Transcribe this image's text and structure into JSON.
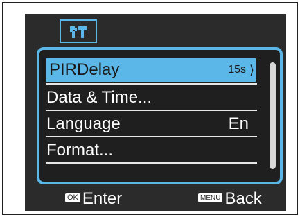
{
  "menu": {
    "items": [
      {
        "label": "PIRDelay",
        "value": "15s"
      },
      {
        "label": "Data & Time...",
        "value": ""
      },
      {
        "label": "Language",
        "value": "En"
      },
      {
        "label": "Format...",
        "value": ""
      }
    ]
  },
  "footer": {
    "ok_badge": "OK",
    "enter_label": "Enter",
    "menu_badge": "MENU",
    "back_label": "Back"
  },
  "colors": {
    "accent": "#5ab7e8",
    "background": "#2b2b2b",
    "text": "#ffffff"
  },
  "icons": {
    "tab": "tools-icon",
    "selected_row": "chevron-right-icon"
  }
}
